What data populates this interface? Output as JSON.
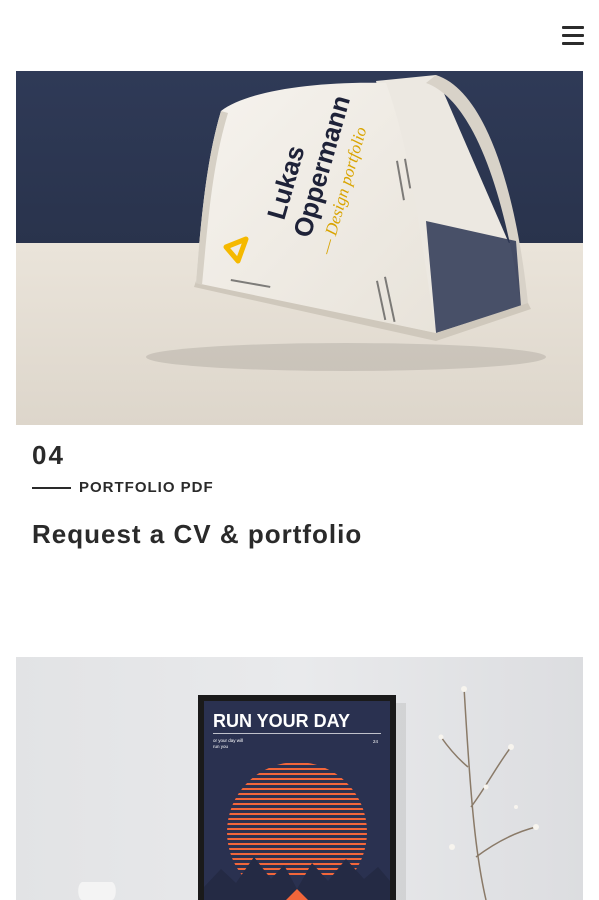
{
  "header": {
    "menu_icon": "hamburger-menu-icon"
  },
  "project": {
    "number": "04",
    "category": "PORTFOLIO PDF",
    "title": "Request a CV & portfolio",
    "image": {
      "book_author": "Lukas Oppermann",
      "book_subtitle": "— Design portfolio",
      "colors": {
        "wall": "#2d3854",
        "table": "#ece6dc",
        "accent": "#f5b900"
      }
    }
  },
  "next_project": {
    "image": {
      "poster_title": "RUN YOUR DAY",
      "poster_line1": "or your day will",
      "poster_line2": "run you",
      "colors": {
        "poster_bg": "#2a3150",
        "stripes": "#f2663a",
        "wall": "#e6e7e9"
      }
    }
  }
}
